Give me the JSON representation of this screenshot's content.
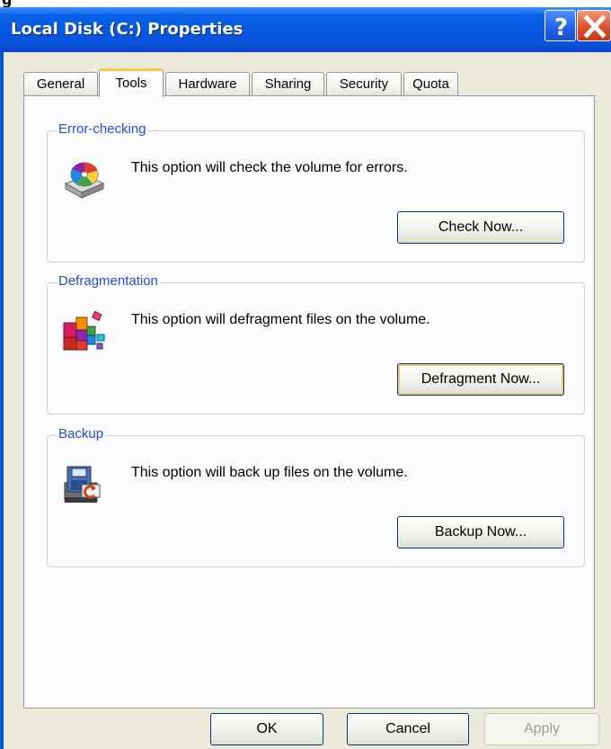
{
  "window": {
    "title": "Local Disk (C:) Properties"
  },
  "tabs": [
    "General",
    "Tools",
    "Hardware",
    "Sharing",
    "Security",
    "Quota"
  ],
  "groups": {
    "error_checking": {
      "label": "Error-checking",
      "text": "This option will check the volume for errors.",
      "button": "Check Now..."
    },
    "defragmentation": {
      "label": "Defragmentation",
      "text": "This option will defragment files on the volume.",
      "button": "Defragment Now..."
    },
    "backup": {
      "label": "Backup",
      "text": "This option will back up files on the volume.",
      "button": "Backup Now..."
    }
  },
  "footer": {
    "ok": "OK",
    "cancel": "Cancel",
    "apply": "Apply"
  },
  "colors": {
    "titlebar": "#0655e0",
    "group_label": "#1f4ed8",
    "active_tab_accent": "#ffc83c",
    "close_button": "#e0502a"
  }
}
